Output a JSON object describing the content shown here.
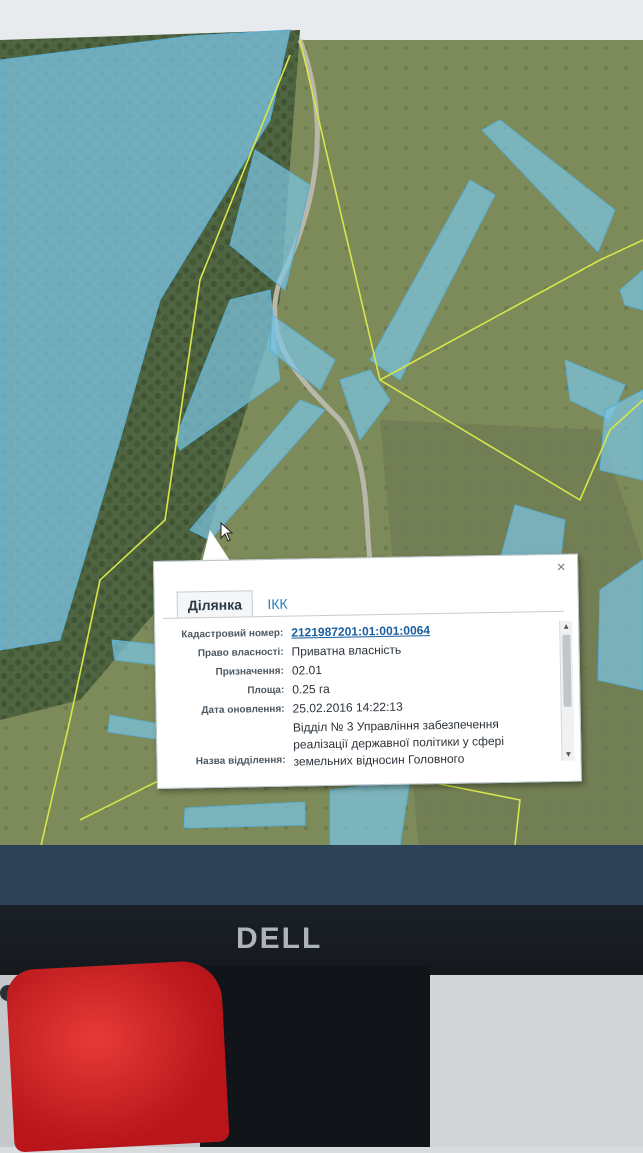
{
  "popup": {
    "close_symbol": "×",
    "tabs": [
      {
        "label": "Ділянка",
        "active": true
      },
      {
        "label": "ІКК",
        "active": false
      }
    ],
    "fields": [
      {
        "label": "Кадастровий номер:",
        "value": "2121987201:01:001:0064"
      },
      {
        "label": "Право власності:",
        "value": "Приватна власність"
      },
      {
        "label": "Призначення:",
        "value": "02.01"
      },
      {
        "label": "Площа:",
        "value": "0.25 га"
      },
      {
        "label": "Дата оновлення:",
        "value": "25.02.2016 14:22:13"
      },
      {
        "label": "Назва відділення:",
        "value": "Відділ № 3 Управління забезпечення реалізації державної політики у сфері земельних відносин Головного"
      }
    ]
  },
  "monitor": {
    "brand": "DELL"
  },
  "colors": {
    "parcel_fill": "#7cc6e6",
    "parcel_stroke": "#5aaed3",
    "boundary": "#d7e64a",
    "accent_link": "#1a5fa0"
  },
  "icons": {
    "close": "close-icon",
    "scroll_up": "arrow-up-icon",
    "scroll_down": "arrow-down-icon",
    "cursor": "mouse-pointer-icon"
  }
}
